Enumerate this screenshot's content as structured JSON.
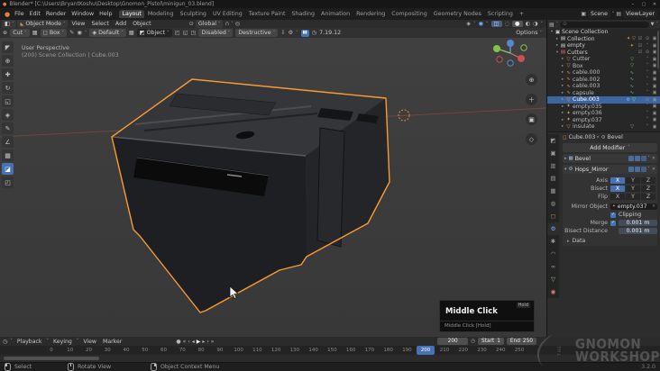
{
  "colors": {
    "accent": "#4772b3",
    "selection-outline": "#fa9a36",
    "axis-red": "#a14d4d",
    "object-orange": "#e0904a",
    "mesh-green": "#8fd18f"
  },
  "window": {
    "title": "Blender* [C:\\Users\\BryantKoshu\\Desktop\\Gnomon_Pistol\\minigun_03.blend]",
    "minimize": "–",
    "maximize": "▢",
    "close": "✕"
  },
  "icons": {
    "logo": "●",
    "dropdown": "˅",
    "editor_3d": "◧",
    "mode": "◣",
    "pivot": "⊙",
    "magnet": "∩",
    "prop_edit": "◎",
    "gizmo": "◈",
    "overlays": "◉",
    "xray": "◫",
    "wireframe": "◌",
    "solid": "●",
    "material": "◐",
    "rendered": "◑",
    "scene": "▣",
    "viewlayer": "▤",
    "cut_tool": "⊕",
    "checker": "▦",
    "box_shape": "◻",
    "brush": "✎",
    "circle": "◉",
    "lock": "◈",
    "grid": "▦",
    "snap_cube": "◩",
    "s1": "◰",
    "s2": "◱",
    "s3": "◳",
    "download": "⇩",
    "gear": "⚙",
    "pause": "▮▮",
    "clock": "◷",
    "outliner_editor": "▤",
    "search": "⊙",
    "funnel": "▼",
    "breadcrumb_obj": "◻",
    "breadcrumb_mod": "⚙",
    "modifier": "⚙",
    "bevel": "▦",
    "mirror_obj": "✦",
    "clear": "✕",
    "expand": "▸",
    "collapse": "▾",
    "record": "●",
    "jump_start": "«",
    "prev_key": "‹",
    "prev": "◂",
    "play": "▶",
    "next": "▸",
    "next_key": "›",
    "jump_end": "»",
    "zoom": "⊕",
    "move": "＋",
    "camera": "▣",
    "persp": "◇"
  },
  "topbar": {
    "file": "File",
    "edit": "Edit",
    "render": "Render",
    "window": "Window",
    "help": "Help",
    "tabs": [
      {
        "label": "Layout",
        "n": "tab-layout",
        "cls": "active"
      },
      {
        "label": "Modeling",
        "n": "tab-modeling"
      },
      {
        "label": "Sculpting",
        "n": "tab-sculpting"
      },
      {
        "label": "UV Editing",
        "n": "tab-uv-editing"
      },
      {
        "label": "Texture Paint",
        "n": "tab-texture-paint"
      },
      {
        "label": "Shading",
        "n": "tab-shading"
      },
      {
        "label": "Animation",
        "n": "tab-animation"
      },
      {
        "label": "Rendering",
        "n": "tab-rendering"
      },
      {
        "label": "Compositing",
        "n": "tab-compositing"
      },
      {
        "label": "Geometry Nodes",
        "n": "tab-geometry-nodes"
      },
      {
        "label": "Scripting",
        "n": "tab-scripting"
      },
      {
        "label": "+",
        "n": "tab-add"
      }
    ],
    "scene": "Scene",
    "view_layer": "ViewLayer"
  },
  "vp_header": {
    "mode": "Object Mode",
    "view": "View",
    "select": "Select",
    "add": "Add",
    "object": "Object",
    "orientation": "Global"
  },
  "tool_settings": {
    "cut": "Cut",
    "box": "Box",
    "falloff": "Default",
    "target": "Object",
    "live": "Disabled",
    "workflow": "Destructive",
    "timer": "7.19.12",
    "options": "Options"
  },
  "toolbar": [
    {
      "g": "◤",
      "n": "tweak-tool"
    },
    {
      "g": "⊕",
      "n": "cursor-tool"
    },
    {
      "g": "✚",
      "n": "move-tool"
    },
    {
      "g": "↻",
      "n": "rotate-tool"
    },
    {
      "g": "◱",
      "n": "scale-tool"
    },
    {
      "g": "◈",
      "n": "transform-tool"
    },
    {
      "g": "✎",
      "n": "annotate-tool"
    },
    {
      "g": "∠",
      "n": "measure-tool"
    },
    {
      "g": "▦",
      "n": "add-cube-tool"
    },
    {
      "g": "◪",
      "n": "boxcutter-tool",
      "cls": "active"
    },
    {
      "g": "◰",
      "n": "hardops-tool"
    }
  ],
  "viewport": {
    "line1": "User Perspective",
    "line2": "(200) Scene Collection | Cube.003"
  },
  "tooltip": {
    "hold": "Hold",
    "title": "Middle Click",
    "sub": "Middle Click [Hold]"
  },
  "outliner": {
    "rows": [
      {
        "pad": "2px",
        "tri": "▾",
        "icon": "▣",
        "ic": "#cfcfcf",
        "name": "Scene Collection",
        "nc": "#d0d0d0"
      },
      {
        "pad": "8px",
        "tri": "▸",
        "icon": "▤",
        "ic": "#d8d8d8",
        "name": "Collection",
        "nc": "#cccccc",
        "e1": "✦",
        "e1c": "#d99a5b",
        "e2": "▽",
        "e2c": "#d99a5b",
        "r1": "☑",
        "r2": "⊙",
        "r3": "▣"
      },
      {
        "pad": "8px",
        "tri": "▸",
        "icon": "▤",
        "ic": "#d8d8d8",
        "name": "empty",
        "nc": "#cccccc",
        "e1": "✦",
        "e1c": "#d99a5b",
        "r1": "☑",
        "r2": "˅",
        "r3": "▣"
      },
      {
        "pad": "8px",
        "tri": "▾",
        "icon": "▤",
        "ic": "#e06a6a",
        "name": "Cutters",
        "nc": "#cccccc",
        "r1": "☑",
        "r2": "⊙",
        "r3": "▣"
      },
      {
        "pad": "14px",
        "tri": "▸",
        "icon": "▽",
        "ic": "#e0904a",
        "name": "Cutter",
        "nc": "#bbbbbb",
        "e1": "▽",
        "e1c": "#7fc97f",
        "r2": "˅",
        "r3": "▣"
      },
      {
        "pad": "14px",
        "tri": "▸",
        "icon": "▽",
        "ic": "#e0904a",
        "name": "Box",
        "nc": "#bbbbbb",
        "e1": "▽",
        "e1c": "#7fc97f",
        "r2": "˅",
        "r3": "▣"
      },
      {
        "pad": "14px",
        "tri": "▸",
        "icon": "∿",
        "ic": "#e0904a",
        "name": "cable.000",
        "nc": "#bbbbbb",
        "e1": "∿",
        "e1c": "#72c7a6",
        "r2": "˅",
        "r3": "▣"
      },
      {
        "pad": "14px",
        "tri": "▸",
        "icon": "∿",
        "ic": "#e0904a",
        "name": "cable.002",
        "nc": "#bbbbbb",
        "e1": "∿",
        "e1c": "#72c7a6",
        "r2": "˅",
        "r3": "▣"
      },
      {
        "pad": "14px",
        "tri": "▸",
        "icon": "∿",
        "ic": "#e0904a",
        "name": "cable.003",
        "nc": "#bbbbbb",
        "e1": "∿",
        "e1c": "#72c7a6",
        "r2": "˅",
        "r3": "▣"
      },
      {
        "pad": "14px",
        "tri": "▸",
        "icon": "∿",
        "ic": "#e0904a",
        "name": "capsule",
        "nc": "#bbbbbb",
        "e1": "∿",
        "e1c": "#72c7a6",
        "r2": "˅",
        "r3": "▣"
      },
      {
        "pad": "14px",
        "tri": "▸",
        "icon": "▽",
        "ic": "#ffb06a",
        "name": "Cube.003",
        "nc": "#ffffff",
        "cls": "sel",
        "e1": "⚙",
        "e1c": "#7ab0ff",
        "e2": "▽",
        "e2c": "#9fe29f",
        "r2": "⊙",
        "r3": "▣"
      },
      {
        "pad": "14px",
        "tri": "▸",
        "icon": "✦",
        "ic": "#d99a5b",
        "name": "empty.035",
        "nc": "#bbbbbb",
        "r2": "˅",
        "r3": "▣"
      },
      {
        "pad": "14px",
        "tri": "▸",
        "icon": "✦",
        "ic": "#d99a5b",
        "name": "empty.036",
        "nc": "#bbbbbb",
        "r2": "˅",
        "r3": "▣"
      },
      {
        "pad": "14px",
        "tri": "▸",
        "icon": "✦",
        "ic": "#d99a5b",
        "name": "empty.037",
        "nc": "#bbbbbb",
        "r2": "˅",
        "r3": "▣"
      },
      {
        "pad": "14px",
        "tri": "▸",
        "icon": "▽",
        "ic": "#e0904a",
        "name": "insulate",
        "nc": "#bbbbbb",
        "e1": "▽",
        "e1c": "#7fc97f",
        "r2": "˅",
        "r3": "▣"
      }
    ]
  },
  "properties": {
    "tabs": [
      {
        "g": "◩",
        "n": "tab-tool",
        "c": "#9a9a9a"
      },
      {
        "g": "▣",
        "n": "tab-render",
        "c": "#9a9a9a"
      },
      {
        "g": "▥",
        "n": "tab-output",
        "c": "#9a9a9a"
      },
      {
        "g": "▤",
        "n": "tab-view-layer",
        "c": "#9a9a9a"
      },
      {
        "g": "▦",
        "n": "tab-scene",
        "c": "#9a9a9a"
      },
      {
        "g": "◍",
        "n": "tab-world",
        "c": "#9a9a9a"
      },
      {
        "g": "◻",
        "n": "tab-object",
        "c": "#d99a5b"
      },
      {
        "g": "⚙",
        "n": "tab-modifiers",
        "c": "#7ab0ff",
        "cls": "active"
      },
      {
        "g": "✱",
        "n": "tab-particles",
        "c": "#9a9a9a"
      },
      {
        "g": "◠",
        "n": "tab-physics",
        "c": "#9a9a9a"
      },
      {
        "g": "∞",
        "n": "tab-constraints",
        "c": "#9a9a9a"
      },
      {
        "g": "▽",
        "n": "tab-data",
        "c": "#8fd18f"
      },
      {
        "g": "◉",
        "n": "tab-material",
        "c": "#d97b7b"
      }
    ],
    "breadcrumb_object": "Cube.003",
    "breadcrumb_sep": "▸",
    "breadcrumb_modifier": "Bevel",
    "add_modifier": "Add Modifier",
    "bevel_name": "Bevel",
    "mirror": {
      "name": "Hops_Mirror",
      "axis": "Axis",
      "bisect": "Bisect",
      "flip": "Flip",
      "x": "X",
      "y": "Y",
      "z": "Z",
      "mirror_object": "Mirror Object",
      "mirror_object_value": "empty.037",
      "clipping": "Clipping",
      "merge": "Merge",
      "merge_value": "0.001 m",
      "bisect_distance": "Bisect Distance",
      "bisect_distance_value": "0.001 m",
      "data": "Data",
      "check": "✓"
    }
  },
  "timeline": {
    "playback": "Playback",
    "keying": "Keying",
    "view": "View",
    "marker": "Marker",
    "frame": "200",
    "start_label": "Start",
    "start": "1",
    "end_label": "End",
    "end": "250",
    "ruler": [
      {
        "label": "0"
      },
      {
        "label": "10"
      },
      {
        "label": "20"
      },
      {
        "label": "30"
      },
      {
        "label": "40"
      },
      {
        "label": "50"
      },
      {
        "label": "60"
      },
      {
        "label": "70"
      },
      {
        "label": "80"
      },
      {
        "label": "90"
      },
      {
        "label": "100"
      },
      {
        "label": "110"
      },
      {
        "label": "120"
      },
      {
        "label": "130"
      },
      {
        "label": "140"
      },
      {
        "label": "150"
      },
      {
        "label": "160"
      },
      {
        "label": "170"
      },
      {
        "label": "180"
      },
      {
        "label": "190"
      },
      {
        "label": "200"
      },
      {
        "label": "210"
      },
      {
        "label": "220"
      },
      {
        "label": "230"
      },
      {
        "label": "240"
      },
      {
        "label": "250"
      }
    ],
    "playhead": "200"
  },
  "statusbar": {
    "select": "Select",
    "rotate": "Rotate View",
    "context": "Object Context Menu",
    "version": "3.2.0"
  },
  "watermark": {
    "the": "THE",
    "line1": "GNOMON",
    "line2": "WORKSHOP"
  }
}
